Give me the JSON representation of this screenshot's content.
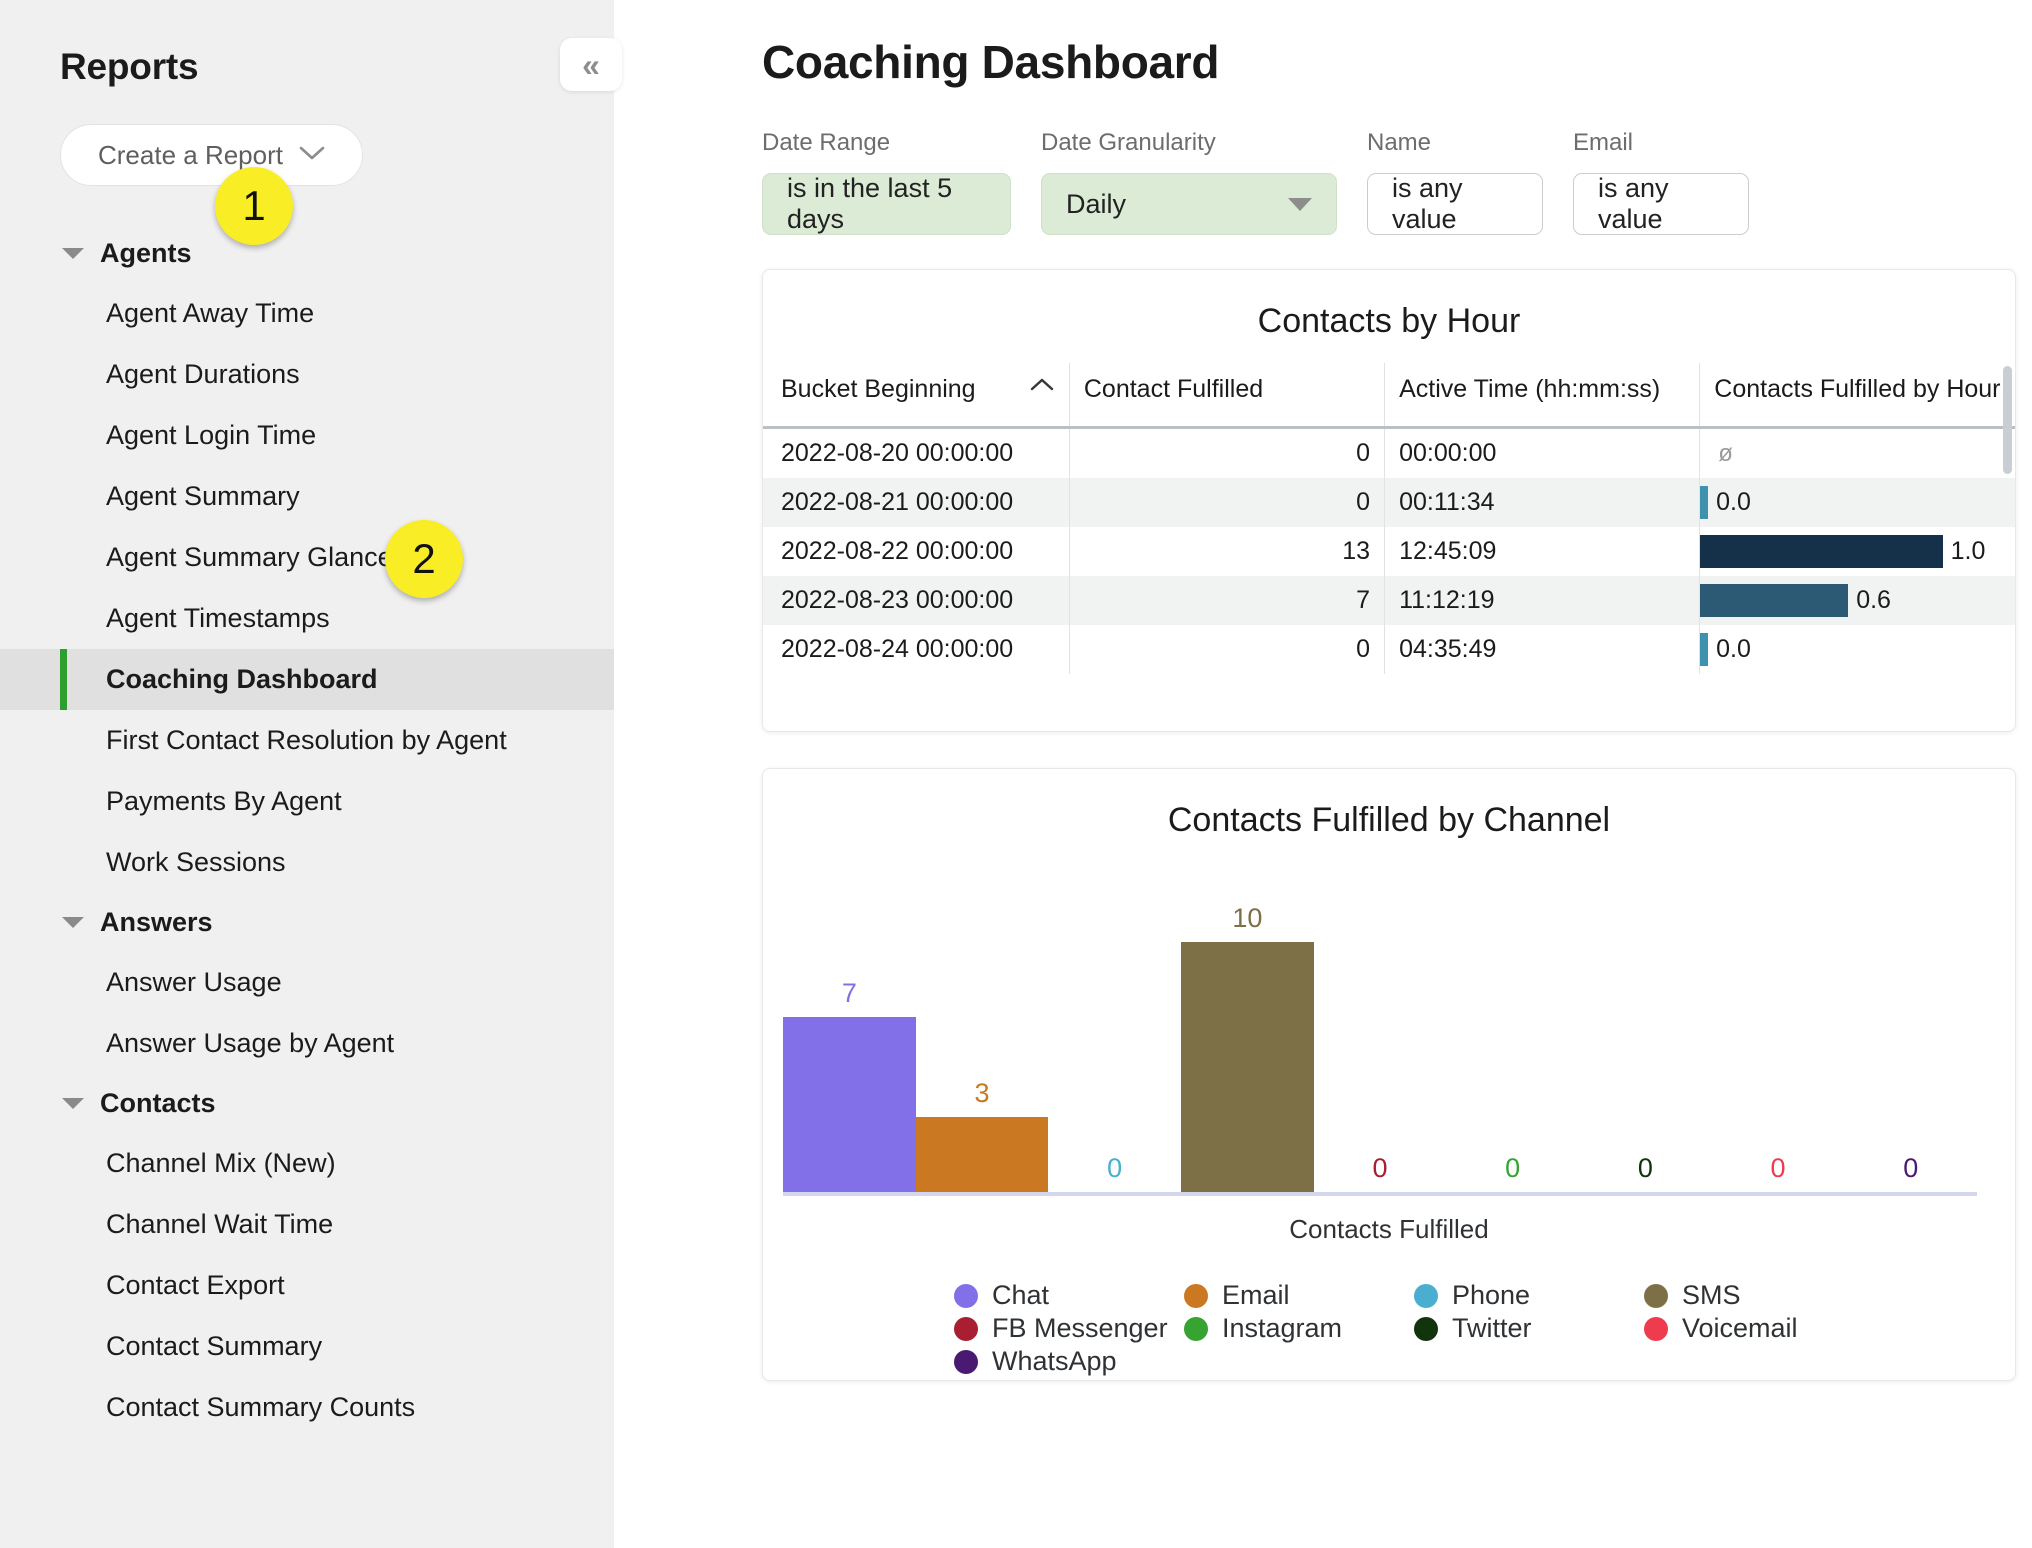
{
  "sidebar": {
    "title": "Reports",
    "create_button": "Create a Report",
    "collapse_icon": "«",
    "groups": [
      {
        "label": "Agents",
        "badge": "1",
        "items": [
          {
            "label": "Agent Away Time",
            "active": false
          },
          {
            "label": "Agent Durations",
            "active": false
          },
          {
            "label": "Agent Login Time",
            "active": false
          },
          {
            "label": "Agent Summary",
            "active": false
          },
          {
            "label": "Agent Summary Glance",
            "active": false
          },
          {
            "label": "Agent Timestamps",
            "active": false
          },
          {
            "label": "Coaching Dashboard",
            "active": true,
            "badge": "2"
          },
          {
            "label": "First Contact Resolution by Agent",
            "active": false
          },
          {
            "label": "Payments By Agent",
            "active": false
          },
          {
            "label": "Work Sessions",
            "active": false
          }
        ]
      },
      {
        "label": "Answers",
        "items": [
          {
            "label": "Answer Usage",
            "active": false
          },
          {
            "label": "Answer Usage by Agent",
            "active": false
          }
        ]
      },
      {
        "label": "Contacts",
        "items": [
          {
            "label": "Channel Mix (New)",
            "active": false
          },
          {
            "label": "Channel Wait Time",
            "active": false
          },
          {
            "label": "Contact Export",
            "active": false
          },
          {
            "label": "Contact Summary",
            "active": false
          },
          {
            "label": "Contact Summary Counts",
            "active": false
          }
        ]
      }
    ]
  },
  "main": {
    "page_title": "Coaching Dashboard",
    "filters": [
      {
        "label": "Date Range",
        "value": "is in the last 5 days",
        "style": "green"
      },
      {
        "label": "Date Granularity",
        "value": "Daily",
        "style": "green",
        "dropdown": true
      },
      {
        "label": "Name",
        "value": "is any value",
        "style": "plain"
      },
      {
        "label": "Email",
        "value": "is any value",
        "style": "plain"
      }
    ]
  },
  "table_card": {
    "title": "Contacts by Hour",
    "sort_indicator": "^",
    "columns": [
      "Bucket Beginning",
      "Contact Fulfilled",
      "Active Time (hh:mm:ss)",
      "Contacts Fulfilled by Hour"
    ],
    "rows": [
      {
        "date": "2022-08-20 00:00:00",
        "fulfilled": "0",
        "active_time": "00:00:00",
        "rate": null,
        "rate_label": "ø",
        "bar_pct": 0,
        "bar_color": "#9a9a9a"
      },
      {
        "date": "2022-08-21 00:00:00",
        "fulfilled": "0",
        "active_time": "00:11:34",
        "rate": "0.0",
        "rate_label": "0.0",
        "bar_pct": 2.5,
        "bar_color": "#3f92ad"
      },
      {
        "date": "2022-08-22 00:00:00",
        "fulfilled": "13",
        "active_time": "12:45:09",
        "rate": "1.0",
        "rate_label": "1.0",
        "bar_pct": 77,
        "bar_color": "#15314a"
      },
      {
        "date": "2022-08-23 00:00:00",
        "fulfilled": "7",
        "active_time": "11:12:19",
        "rate": "0.6",
        "rate_label": "0.6",
        "bar_pct": 47,
        "bar_color": "#2c5a74"
      },
      {
        "date": "2022-08-24 00:00:00",
        "fulfilled": "0",
        "active_time": "04:35:49",
        "rate": "0.0",
        "rate_label": "0.0",
        "bar_pct": 2.5,
        "bar_color": "#3f92ad"
      }
    ]
  },
  "chart_data": {
    "type": "bar",
    "title": "Contacts Fulfilled by Channel",
    "xlabel": "Contacts Fulfilled",
    "ylabel": "",
    "ylim": [
      0,
      12
    ],
    "grid": false,
    "legend_position": "bottom",
    "categories": [
      "Chat",
      "Email",
      "Phone",
      "SMS",
      "FB Messenger",
      "Instagram",
      "Twitter",
      "Voicemail",
      "WhatsApp"
    ],
    "values": [
      7,
      3,
      0,
      10,
      0,
      0,
      0,
      0,
      0
    ],
    "colors": [
      "#8270e8",
      "#ca7822",
      "#4aaed0",
      "#7d7047",
      "#a81f33",
      "#37a330",
      "#11340d",
      "#ef3b4e",
      "#4a1a73"
    ],
    "series": [
      {
        "name": "Contacts Fulfilled",
        "values": [
          7,
          3,
          0,
          10,
          0,
          0,
          0,
          0,
          0
        ]
      }
    ],
    "legend": [
      {
        "label": "Chat",
        "color": "#8270e8"
      },
      {
        "label": "FB Messenger",
        "color": "#a81f33"
      },
      {
        "label": "WhatsApp",
        "color": "#4a1a73"
      },
      {
        "label": "Email",
        "color": "#ca7822"
      },
      {
        "label": "Instagram",
        "color": "#37a330"
      },
      {
        "label": "Phone",
        "color": "#4aaed0"
      },
      {
        "label": "Twitter",
        "color": "#11340d"
      },
      {
        "label": "SMS",
        "color": "#7d7047"
      },
      {
        "label": "Voicemail",
        "color": "#ef3b4e"
      }
    ],
    "legend_columns": [
      [
        {
          "label": "Chat",
          "color": "#8270e8"
        },
        {
          "label": "FB Messenger",
          "color": "#a81f33"
        },
        {
          "label": "WhatsApp",
          "color": "#4a1a73"
        }
      ],
      [
        {
          "label": "Email",
          "color": "#ca7822"
        },
        {
          "label": "Instagram",
          "color": "#37a330"
        }
      ],
      [
        {
          "label": "Phone",
          "color": "#4aaed0"
        },
        {
          "label": "Twitter",
          "color": "#11340d"
        }
      ],
      [
        {
          "label": "SMS",
          "color": "#7d7047"
        },
        {
          "label": "Voicemail",
          "color": "#ef3b4e"
        }
      ]
    ]
  }
}
